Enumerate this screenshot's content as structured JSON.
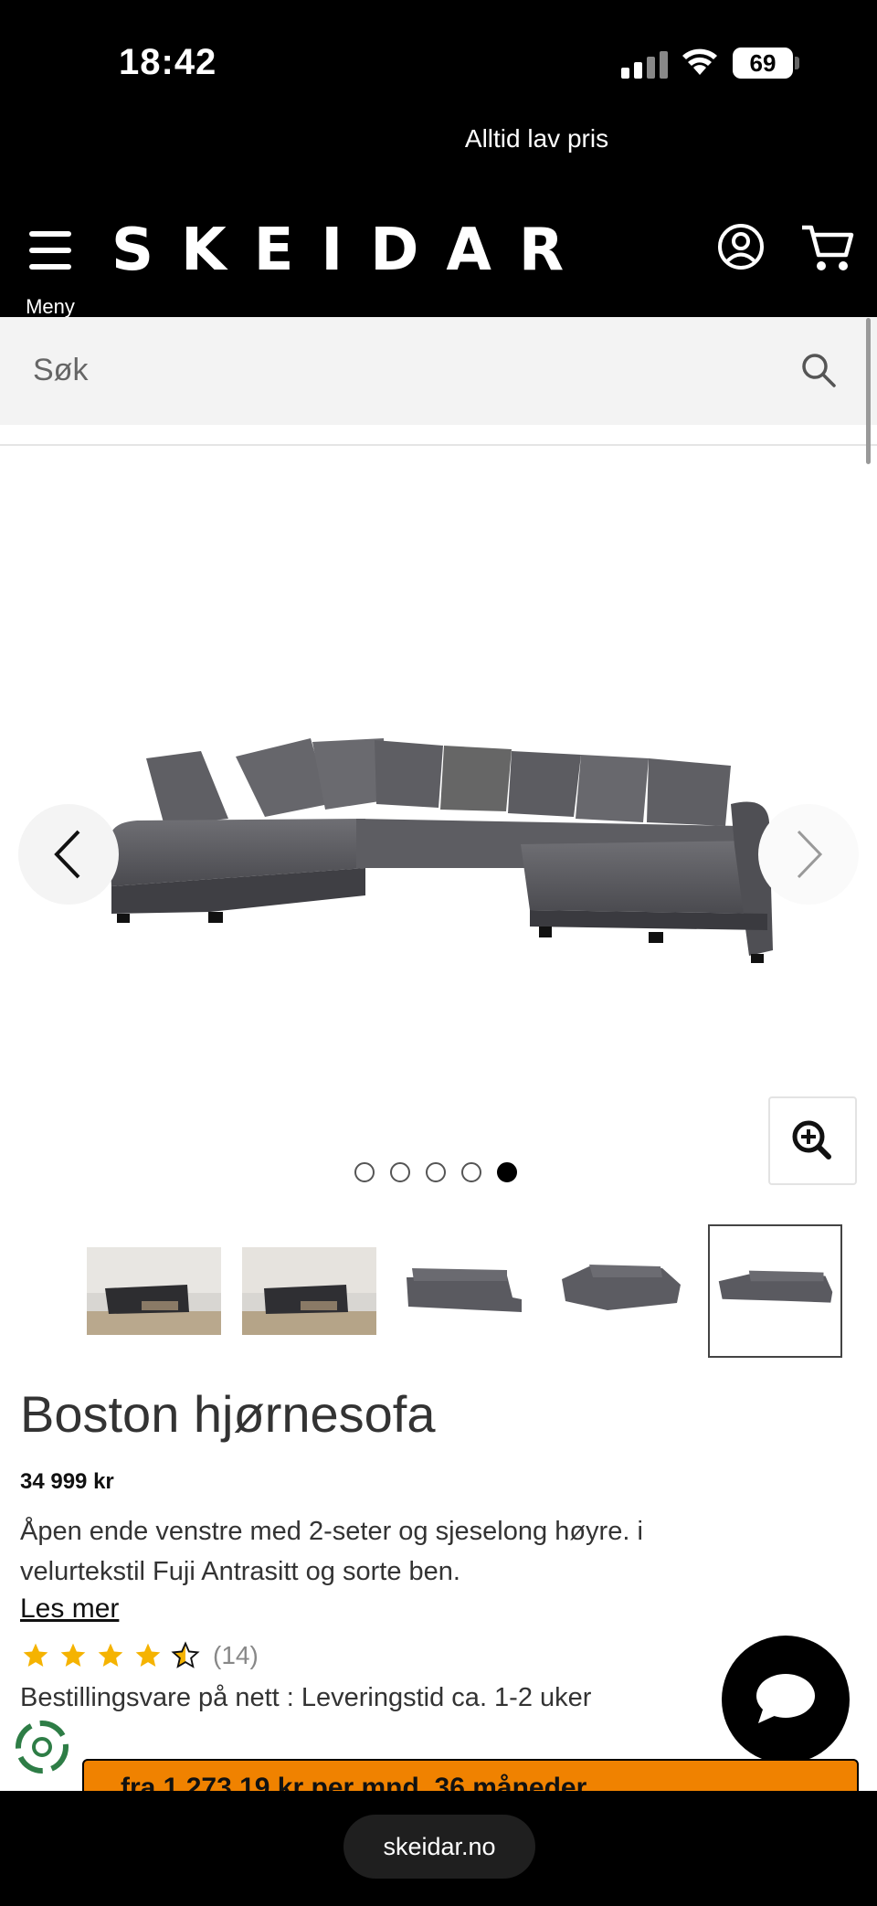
{
  "status_bar": {
    "time": "18:42",
    "battery": "69"
  },
  "promo": {
    "text": "Alltid lav pris"
  },
  "header": {
    "menu_label": "Meny",
    "logo": "SKEIDAR"
  },
  "search": {
    "placeholder": "Søk"
  },
  "gallery": {
    "image_count": 5,
    "active_index": 4
  },
  "thumbnails": [
    {
      "name": "thumbnail-1",
      "scene": "room"
    },
    {
      "name": "thumbnail-2",
      "scene": "room"
    },
    {
      "name": "thumbnail-3",
      "scene": "sofa"
    },
    {
      "name": "thumbnail-4",
      "scene": "sofa"
    },
    {
      "name": "thumbnail-5",
      "scene": "sofa",
      "selected": true
    }
  ],
  "product": {
    "title": "Boston hjørnesofa",
    "price": "34 999 kr",
    "description": "Åpen ende venstre med 2-seter og sjeselong høyre. i velurtekstil Fuji Antrasitt og sorte ben.",
    "read_more": "Les mer",
    "rating": 4.5,
    "review_count": "(14)",
    "delivery": "Bestillingsvare på nett : Leveringstid ca. 1-2 uker"
  },
  "buy_button": {
    "label": "fra 1 273,19 kr per mnd, 36 måneder"
  },
  "browser": {
    "url": "skeidar.no"
  },
  "colors": {
    "accent": "#f08200",
    "header_bg": "#000000",
    "star": "#f5b301"
  }
}
